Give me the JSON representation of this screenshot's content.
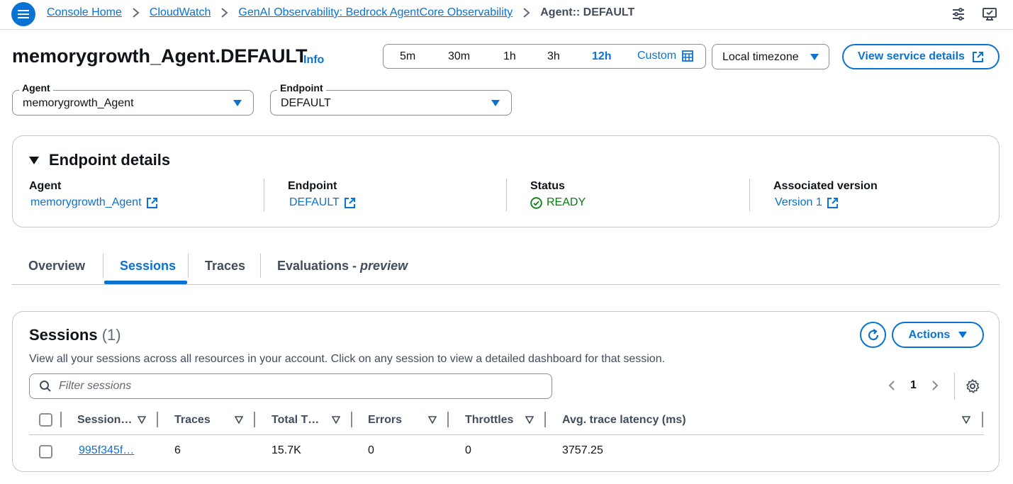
{
  "breadcrumb": {
    "items": [
      "Console Home",
      "CloudWatch",
      "GenAI Observability: Bedrock AgentCore Observability"
    ],
    "current": "Agent:: DEFAULT"
  },
  "header": {
    "title": "memorygrowth_Agent.DEFAULT",
    "info": "Info",
    "time_range": {
      "options": [
        "5m",
        "30m",
        "1h",
        "3h",
        "12h"
      ],
      "selected": "12h",
      "custom": "Custom"
    },
    "timezone": "Local timezone",
    "view_service_details": "View service details"
  },
  "selectors": {
    "agent": {
      "label": "Agent",
      "value": "memorygrowth_Agent"
    },
    "endpoint": {
      "label": "Endpoint",
      "value": "DEFAULT"
    }
  },
  "endpoint_details": {
    "title": "Endpoint details",
    "agent": {
      "label": "Agent",
      "value": "memorygrowth_Agent"
    },
    "endpoint": {
      "label": "Endpoint",
      "value": "DEFAULT"
    },
    "status": {
      "label": "Status",
      "value": "READY"
    },
    "version": {
      "label": "Associated version",
      "value": "Version 1"
    }
  },
  "tabs": {
    "items": [
      "Overview",
      "Sessions",
      "Traces"
    ],
    "evaluations": "Evaluations -",
    "evaluations_suffix": "preview",
    "active": "Sessions"
  },
  "sessions": {
    "title": "Sessions",
    "count": "(1)",
    "description": "View all your sessions across all resources in your account. Click on any session to view a detailed dashboard for that session.",
    "filter_placeholder": "Filter sessions",
    "actions": "Actions",
    "page": "1",
    "columns": [
      "Session…",
      "Traces",
      "Total T…",
      "Errors",
      "Throttles",
      "Avg. trace latency (ms)"
    ],
    "rows": [
      {
        "session": "995f345f…",
        "traces": "6",
        "total": "15.7K",
        "errors": "0",
        "throttles": "0",
        "latency": "3757.25"
      }
    ]
  },
  "colors": {
    "accent": "#0972d3",
    "success": "#037f0c",
    "border": "#c6c6cd",
    "text": "#0f141a"
  }
}
